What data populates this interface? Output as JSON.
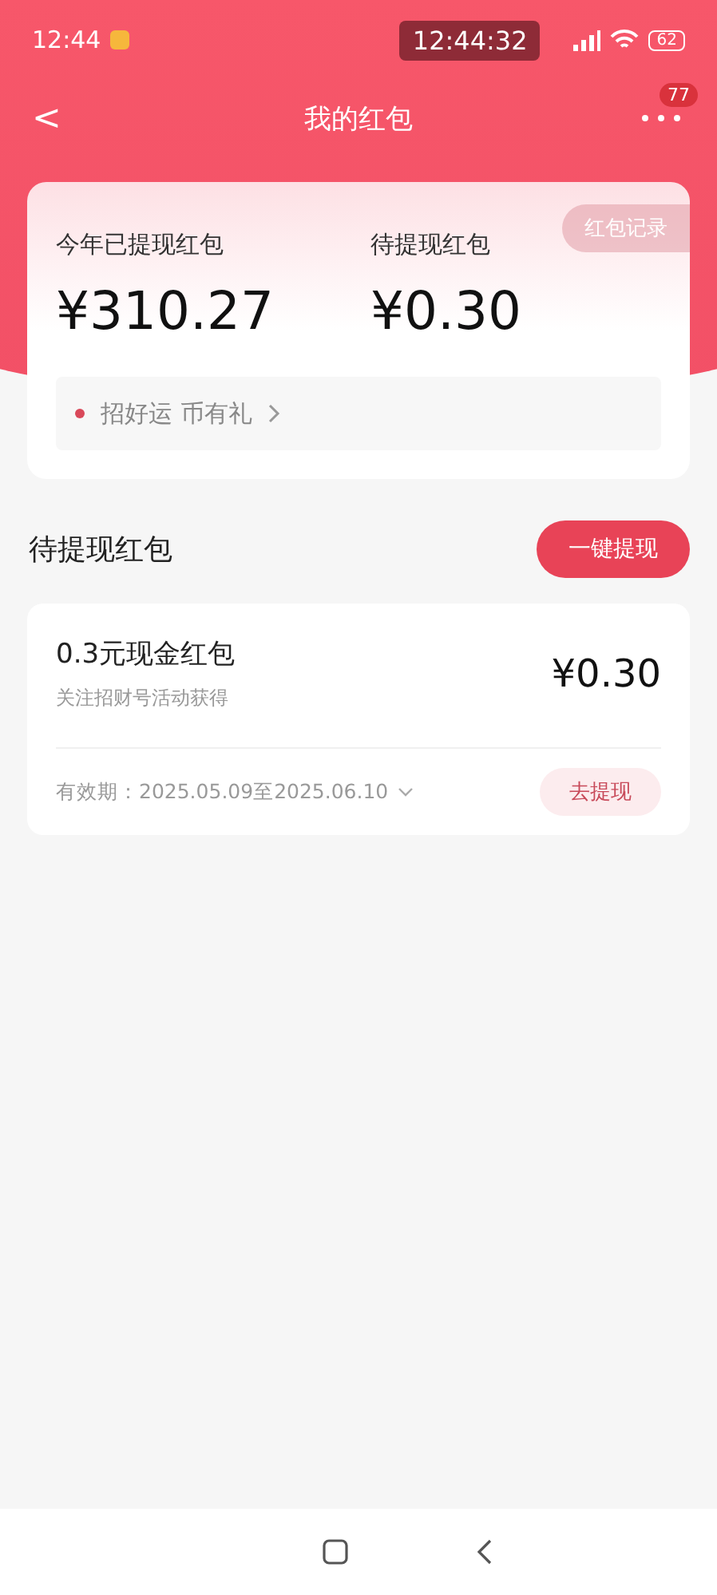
{
  "status_bar": {
    "time": "12:44",
    "clock_overlay": "12:44:32",
    "battery": "62"
  },
  "header": {
    "back": "<",
    "title": "我的红包",
    "more_badge": "77"
  },
  "summary": {
    "record_button": "红包记录",
    "stats": [
      {
        "label": "今年已提现红包",
        "amount": "¥310.27"
      },
      {
        "label": "待提现红包",
        "amount": "¥0.30"
      }
    ],
    "promo": {
      "text": "招好运 币有礼"
    }
  },
  "pending": {
    "title": "待提现红包",
    "withdraw_all": "一键提现",
    "items": [
      {
        "name": "0.3元现金红包",
        "source": "关注招财号活动获得",
        "amount": "¥0.30",
        "validity": "有效期：2025.05.09至2025.06.10",
        "action": "去提现"
      }
    ]
  }
}
